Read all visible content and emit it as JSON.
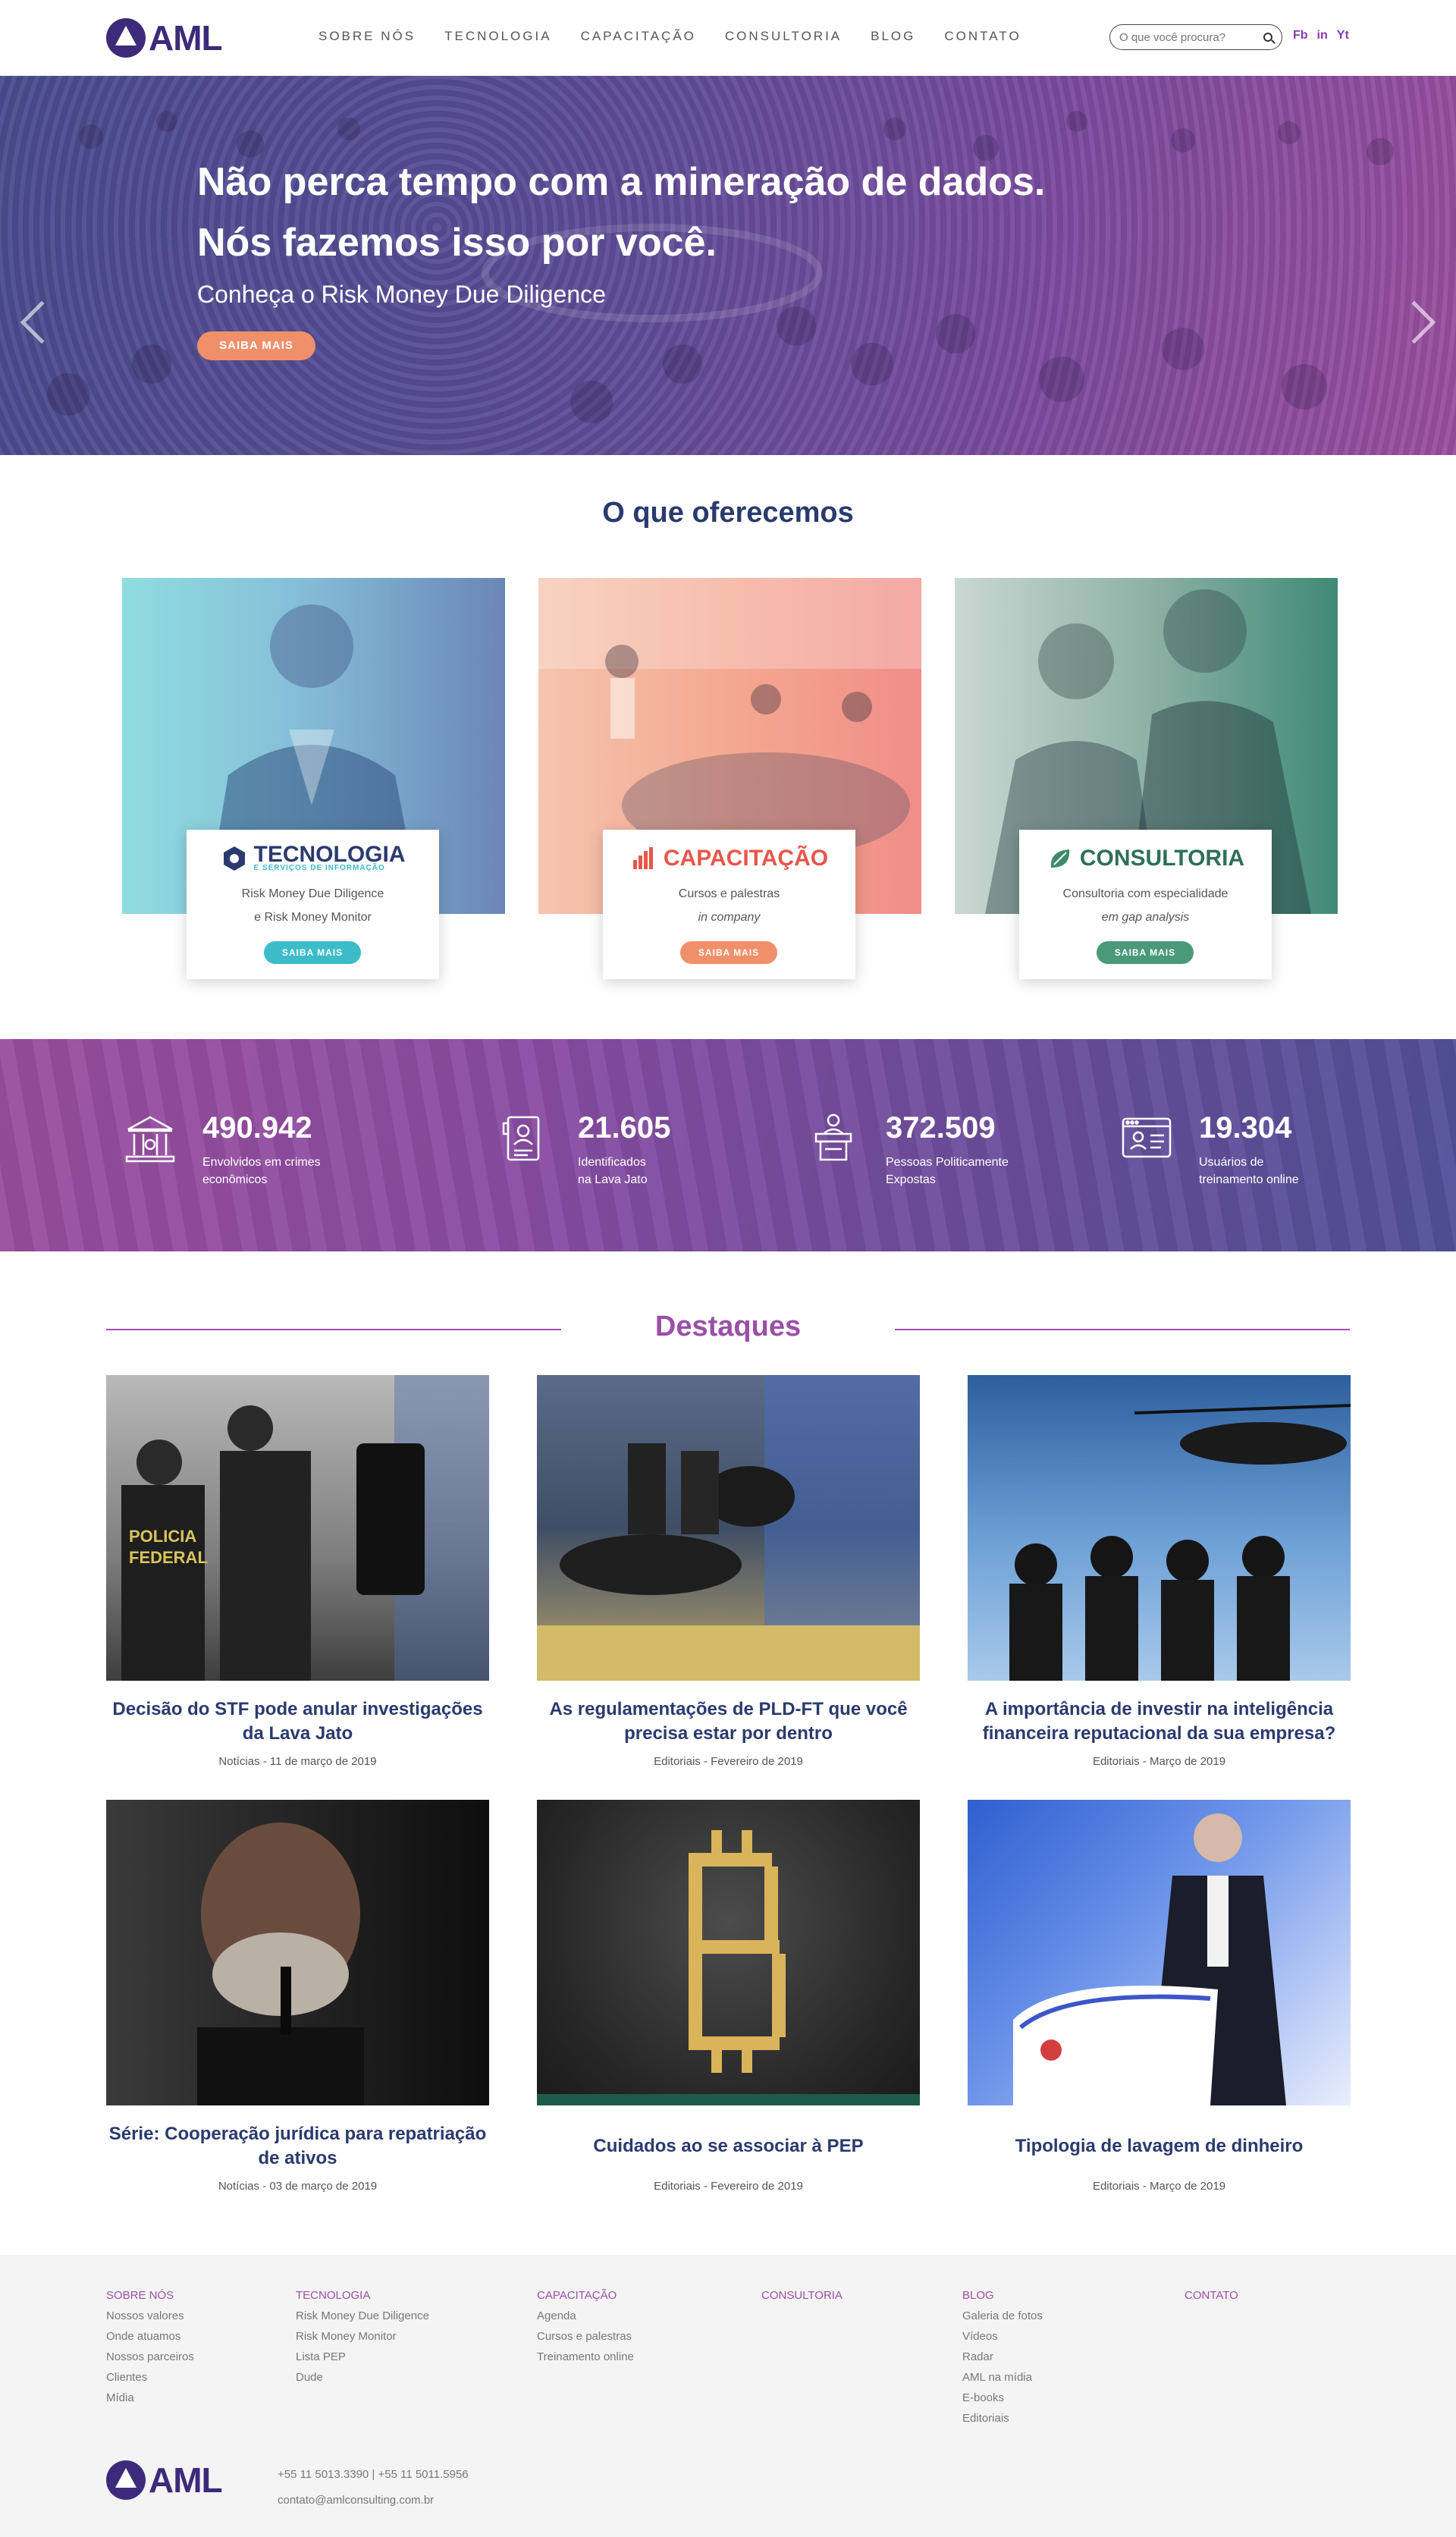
{
  "header": {
    "logo_text": "AML",
    "nav": [
      "SOBRE NÓS",
      "TECNOLOGIA",
      "CAPACITAÇÃO",
      "CONSULTORIA",
      "BLOG",
      "CONTATO"
    ],
    "search_placeholder": "O que você procura?",
    "social": [
      "Fb",
      "in",
      "Yt"
    ]
  },
  "hero": {
    "title_line1": "Não perca tempo com a mineração de dados.",
    "title_line2": "Nós fazemos isso por você.",
    "subtitle": "Conheça o Risk Money Due Diligence",
    "button": "SAIBA MAIS",
    "slides": 4,
    "active_slide": 1
  },
  "offer": {
    "title": "O que oferecemos",
    "cards": [
      {
        "brand": "TECNOLOGIA",
        "brand_tag": "E SERVIÇOS DE INFORMAÇÃO",
        "line1": "Risk Money Due Diligence",
        "line2": "e Risk Money Monitor",
        "button": "SAIBA MAIS",
        "color": "#3cbcc9"
      },
      {
        "brand": "CAPACITAÇÃO",
        "brand_tag": "",
        "line1": "Cursos e palestras",
        "line2": "in company",
        "button": "SAIBA MAIS",
        "color": "#f0906a"
      },
      {
        "brand": "CONSULTORIA",
        "brand_tag": "",
        "line1": "Consultoria com especialidade",
        "line2": "em gap analysis",
        "button": "SAIBA MAIS",
        "color": "#4a9a7a"
      }
    ]
  },
  "stats": [
    {
      "number": "490.942",
      "label1": "Envolvidos em crimes",
      "label2": "econômicos",
      "icon": "bank-icon"
    },
    {
      "number": "21.605",
      "label1": "Identificados",
      "label2": "na Lava Jato",
      "icon": "document-icon"
    },
    {
      "number": "372.509",
      "label1": "Pessoas Politicamente",
      "label2": "Expostas",
      "icon": "podium-icon"
    },
    {
      "number": "19.304",
      "label1": "Usuários de",
      "label2": "treinamento online",
      "icon": "browser-user-icon"
    }
  ],
  "highlights": {
    "title": "Destaques",
    "items": [
      {
        "title": "Decisão do STF pode anular investigações da Lava Jato",
        "meta": "Notícias - 11 de março de 2019"
      },
      {
        "title": "As regulamentações de PLD-FT que você precisa estar por dentro",
        "meta": "Editoriais - Fevereiro de 2019"
      },
      {
        "title": "A importância de investir na inteligência financeira reputacional da sua empresa?",
        "meta": "Editoriais - Março de 2019"
      },
      {
        "title": "Série: Cooperação jurídica para repatriação de ativos",
        "meta": "Notícias - 03 de março de 2019"
      },
      {
        "title": "Cuidados ao se associar à PEP",
        "meta": "Editoriais - Fevereiro de 2019"
      },
      {
        "title": "Tipologia de lavagem de dinheiro",
        "meta": "Editoriais - Março de 2019"
      }
    ]
  },
  "footer": {
    "columns": [
      {
        "head": "SOBRE NÓS",
        "items": [
          "Nossos valores",
          "Onde atuamos",
          "Nossos parceiros",
          "Clientes",
          "Mídia"
        ]
      },
      {
        "head": "TECNOLOGIA",
        "items": [
          "Risk Money Due Diligence",
          "Risk Money Monitor",
          "Lista PEP",
          "Dude"
        ]
      },
      {
        "head": "CAPACITAÇÃO",
        "items": [
          "Agenda",
          "Cursos e palestras",
          "Treinamento online"
        ]
      },
      {
        "head": "CONSULTORIA",
        "items": []
      },
      {
        "head": "BLOG",
        "items": [
          "Galeria de fotos",
          "Vídeos",
          "Radar",
          "AML na mídia",
          "E-books",
          "Editoriais"
        ]
      },
      {
        "head": "CONTATO",
        "items": []
      }
    ],
    "phone": "+55 11 5013.3390 | +55 11 5011.5956",
    "email": "contato@amlconsulting.com.br",
    "logo_text": "AML"
  }
}
